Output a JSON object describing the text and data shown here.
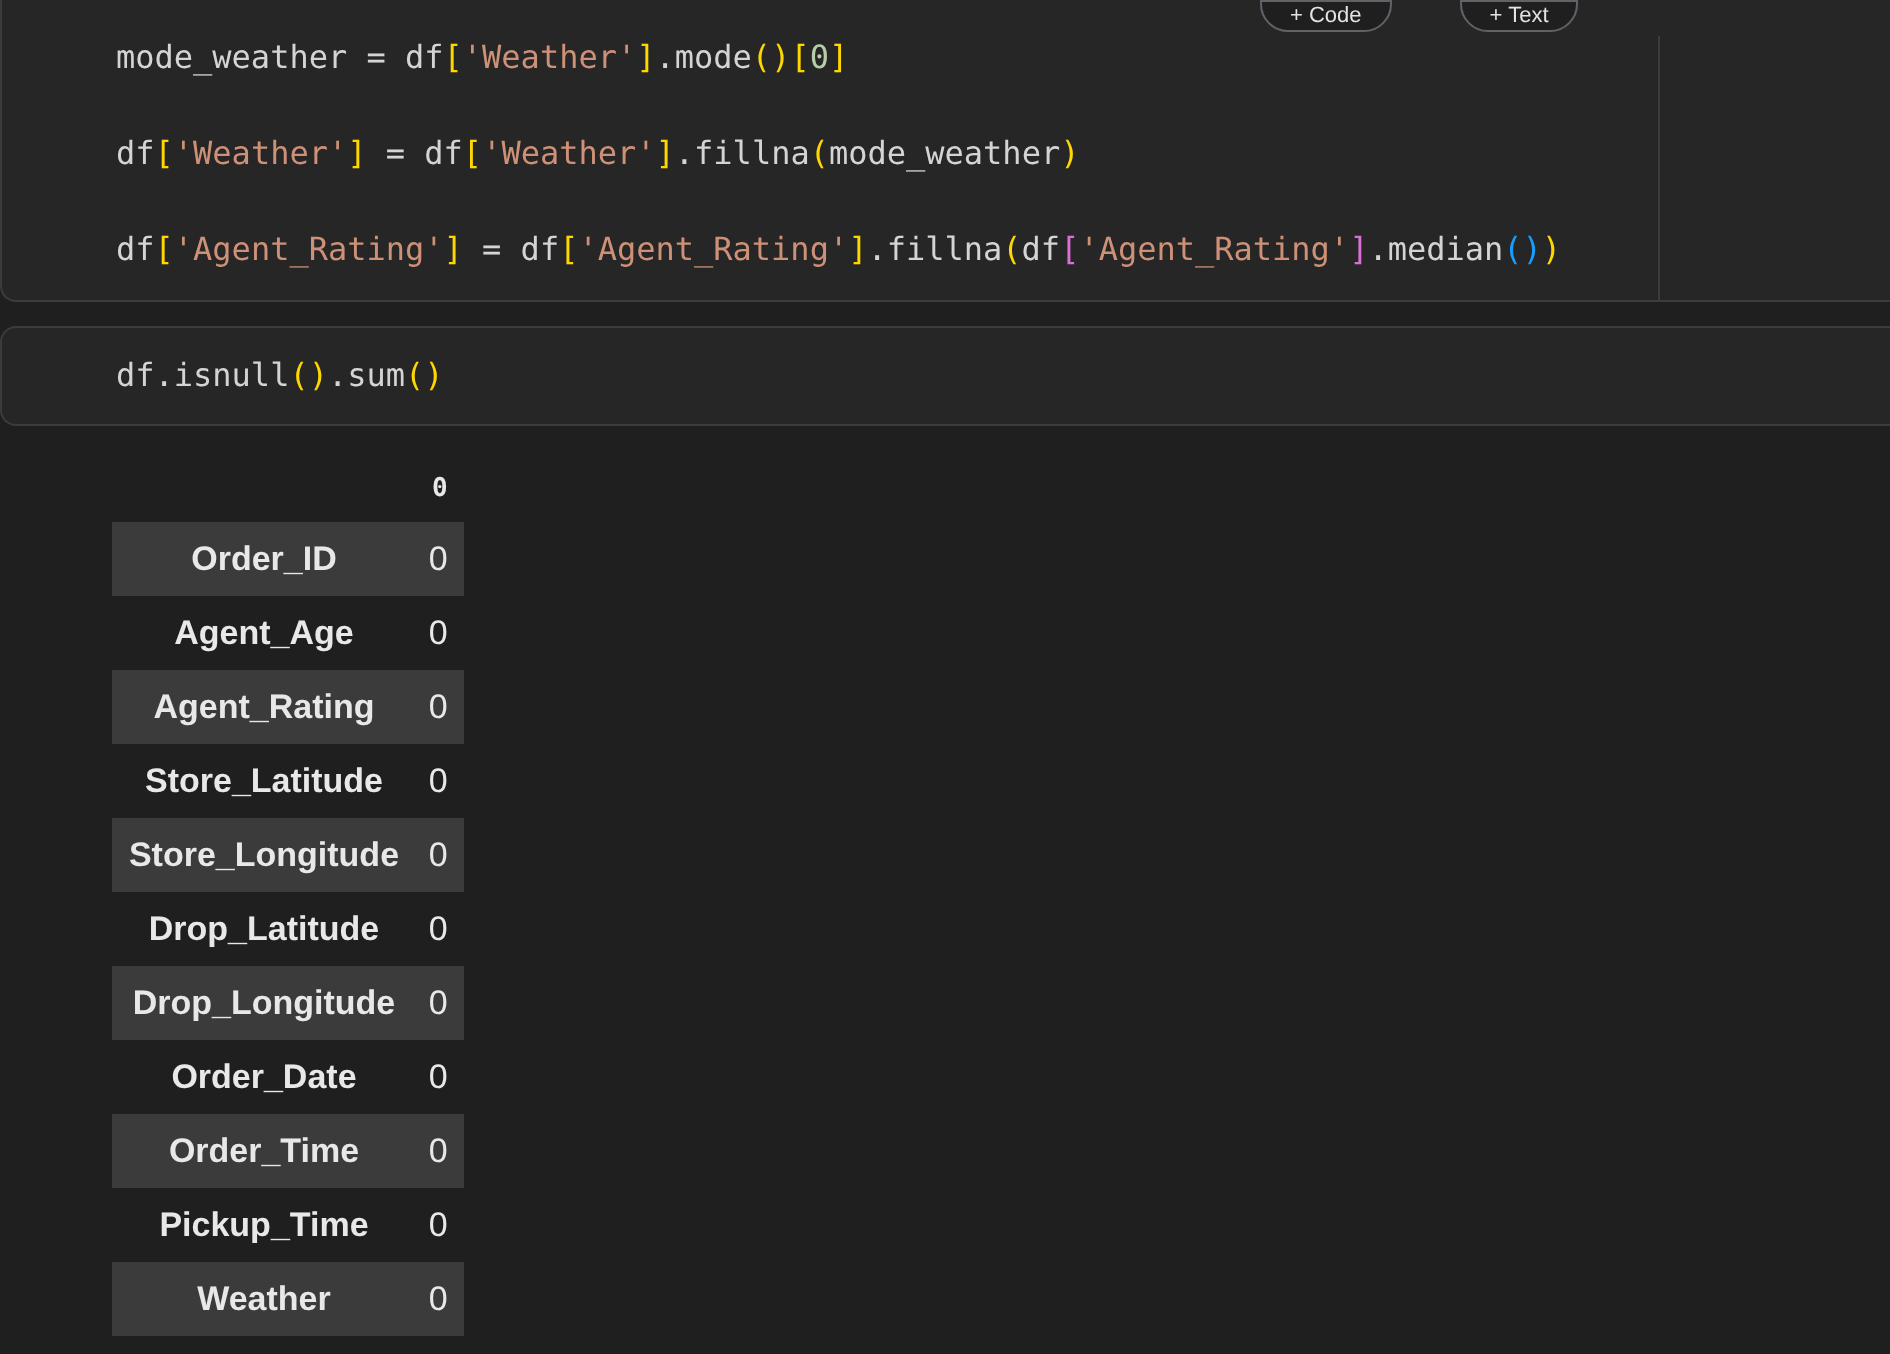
{
  "toolbar_buttons": [
    {
      "icon": "+",
      "label": "Code"
    },
    {
      "icon": "+",
      "label": "Text"
    }
  ],
  "cells": [
    {
      "lines": [
        [
          {
            "kind": "plain",
            "text": "mode_weather = df"
          },
          {
            "kind": "bracket1",
            "text": "["
          },
          {
            "kind": "string",
            "text": "'Weather'"
          },
          {
            "kind": "bracket1",
            "text": "]"
          },
          {
            "kind": "plain",
            "text": ".mode"
          },
          {
            "kind": "bracket1",
            "text": "()"
          },
          {
            "kind": "bracket1",
            "text": "["
          },
          {
            "kind": "number",
            "text": "0"
          },
          {
            "kind": "bracket1",
            "text": "]"
          }
        ],
        [
          {
            "kind": "plain",
            "text": "df"
          },
          {
            "kind": "bracket1",
            "text": "["
          },
          {
            "kind": "string",
            "text": "'Weather'"
          },
          {
            "kind": "bracket1",
            "text": "]"
          },
          {
            "kind": "plain",
            "text": " = df"
          },
          {
            "kind": "bracket1",
            "text": "["
          },
          {
            "kind": "string",
            "text": "'Weather'"
          },
          {
            "kind": "bracket1",
            "text": "]"
          },
          {
            "kind": "plain",
            "text": ".fillna"
          },
          {
            "kind": "bracket1",
            "text": "("
          },
          {
            "kind": "plain",
            "text": "mode_weather"
          },
          {
            "kind": "bracket1",
            "text": ")"
          }
        ],
        [
          {
            "kind": "plain",
            "text": "df"
          },
          {
            "kind": "bracket1",
            "text": "["
          },
          {
            "kind": "string",
            "text": "'Agent_Rating'"
          },
          {
            "kind": "bracket1",
            "text": "]"
          },
          {
            "kind": "plain",
            "text": " = df"
          },
          {
            "kind": "bracket1",
            "text": "["
          },
          {
            "kind": "string",
            "text": "'Agent_Rating'"
          },
          {
            "kind": "bracket1",
            "text": "]"
          },
          {
            "kind": "plain",
            "text": ".fillna"
          },
          {
            "kind": "bracket1",
            "text": "("
          },
          {
            "kind": "plain",
            "text": "df"
          },
          {
            "kind": "bracket2",
            "text": "["
          },
          {
            "kind": "string",
            "text": "'Agent_Rating'"
          },
          {
            "kind": "bracket2",
            "text": "]"
          },
          {
            "kind": "plain",
            "text": ".median"
          },
          {
            "kind": "bracket3",
            "text": "()"
          },
          {
            "kind": "bracket1",
            "text": ")"
          }
        ]
      ]
    },
    {
      "lines": [
        [
          {
            "kind": "plain",
            "text": "df.isnull"
          },
          {
            "kind": "bracket1",
            "text": "()"
          },
          {
            "kind": "plain",
            "text": ".sum"
          },
          {
            "kind": "bracket1",
            "text": "()"
          }
        ]
      ]
    }
  ],
  "output": {
    "column": "0",
    "rows": [
      {
        "index": "Order_ID",
        "value": "0"
      },
      {
        "index": "Agent_Age",
        "value": "0"
      },
      {
        "index": "Agent_Rating",
        "value": "0"
      },
      {
        "index": "Store_Latitude",
        "value": "0"
      },
      {
        "index": "Store_Longitude",
        "value": "0"
      },
      {
        "index": "Drop_Latitude",
        "value": "0"
      },
      {
        "index": "Drop_Longitude",
        "value": "0"
      },
      {
        "index": "Order_Date",
        "value": "0"
      },
      {
        "index": "Order_Time",
        "value": "0"
      },
      {
        "index": "Pickup_Time",
        "value": "0"
      },
      {
        "index": "Weather",
        "value": "0"
      }
    ]
  }
}
